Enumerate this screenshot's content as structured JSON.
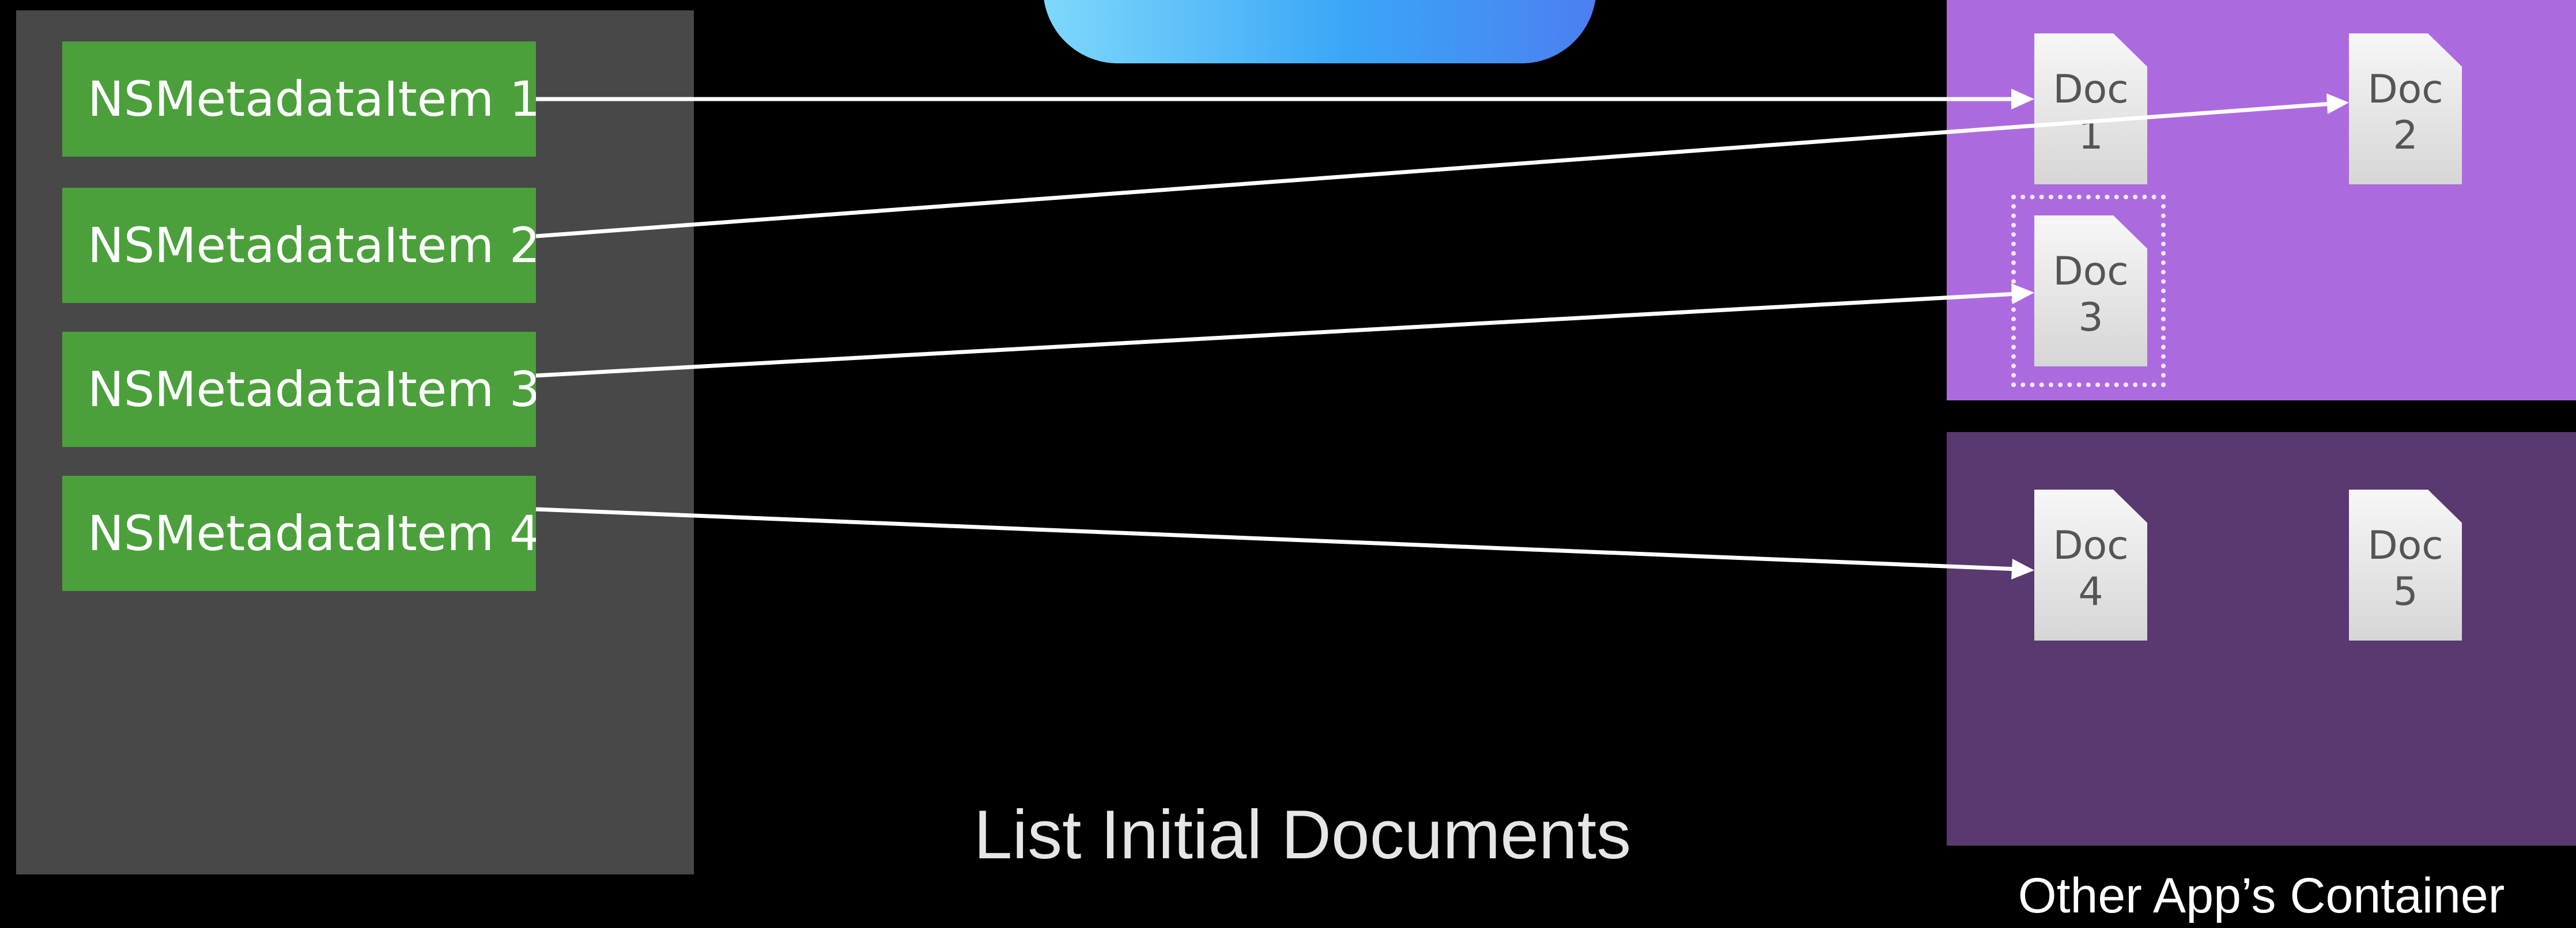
{
  "colors": {
    "background": "#000000",
    "left_panel": "#484848",
    "metadata_item": "#4ba03b",
    "container_top": "#ac6adf",
    "container_bottom": "#5a3870",
    "arrow": "#ffffff",
    "cloud": "#3aa6f7"
  },
  "metadata_items": [
    "NSMetadataItem 1",
    "NSMetadataItem 2",
    "NSMetadataItem 3",
    "NSMetadataItem 4"
  ],
  "documents": [
    {
      "label": "Doc",
      "number": "1"
    },
    {
      "label": "Doc",
      "number": "2"
    },
    {
      "label": "Doc",
      "number": "3"
    },
    {
      "label": "Doc",
      "number": "4"
    },
    {
      "label": "Doc",
      "number": "5"
    }
  ],
  "caption": "List Initial Documents",
  "other_container_label": "Other App’s Container",
  "icons": {
    "cloud": "icloud-shape",
    "document": "document-page-icon"
  }
}
